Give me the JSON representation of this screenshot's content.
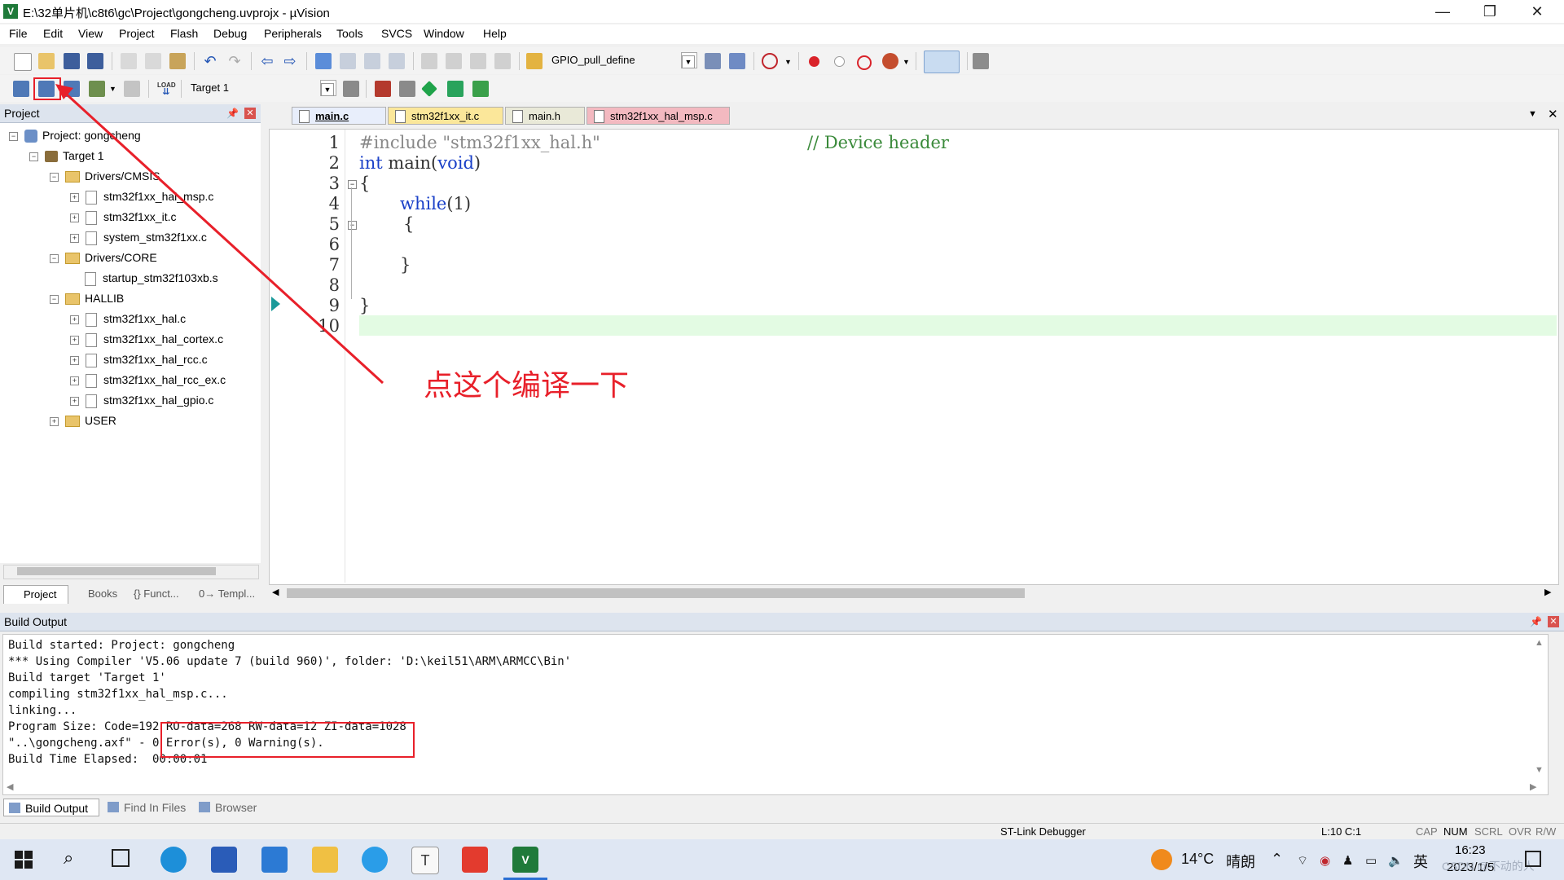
{
  "window": {
    "title": "E:\\32单片机\\c8t6\\gc\\Project\\gongcheng.uvprojx - µVision",
    "minimize": "—",
    "restore": "❐",
    "close": "✕"
  },
  "menu": [
    "File",
    "Edit",
    "View",
    "Project",
    "Flash",
    "Debug",
    "Peripherals",
    "Tools",
    "SVCS",
    "Window",
    "Help"
  ],
  "toolbar1": {
    "search_combo": "GPIO_pull_define"
  },
  "toolbar2": {
    "target_combo": "Target 1",
    "load_label": "LOAD"
  },
  "project_pane": {
    "title": "Project",
    "root": "Project: gongcheng",
    "target": "Target 1",
    "groups": [
      {
        "name": "Drivers/CMSIS",
        "files": [
          "stm32f1xx_hal_msp.c",
          "stm32f1xx_it.c",
          "system_stm32f1xx.c"
        ]
      },
      {
        "name": "Drivers/CORE",
        "files": [
          "startup_stm32f103xb.s"
        ]
      },
      {
        "name": "HALLIB",
        "files": [
          "stm32f1xx_hal.c",
          "stm32f1xx_hal_cortex.c",
          "stm32f1xx_hal_rcc.c",
          "stm32f1xx_hal_rcc_ex.c",
          "stm32f1xx_hal_gpio.c"
        ]
      },
      {
        "name": "USER",
        "files": []
      }
    ],
    "tabs": [
      "Project",
      "Books",
      "{} Funct...",
      "0→ Templ..."
    ]
  },
  "editor": {
    "tabs": [
      {
        "label": "main.c",
        "color": "#e8eefb"
      },
      {
        "label": "stm32f1xx_it.c",
        "color": "#fbe79a"
      },
      {
        "label": "main.h",
        "color": "#e9e9d8"
      },
      {
        "label": "stm32f1xx_hal_msp.c",
        "color": "#f3b9c0"
      }
    ],
    "line_numbers": [
      "1",
      "2",
      "3",
      "4",
      "5",
      "6",
      "7",
      "8",
      "9",
      "10"
    ],
    "code": {
      "l1_include": "#include ",
      "l1_header": "\"stm32f1xx_hal.h\"",
      "l1_comment": "// Device header",
      "l2_int": "int",
      "l2_main": " main(",
      "l2_void": "void",
      "l2_close": ")",
      "l3": "{",
      "l4_while": "while",
      "l4_args": "(1)",
      "l5": "{",
      "l7": "}",
      "l9": "}"
    }
  },
  "annotation": {
    "text": "点这个编译一下",
    "color": "#e8202a"
  },
  "build_output": {
    "title": "Build Output",
    "lines": [
      "Build started: Project: gongcheng",
      "*** Using Compiler 'V5.06 update 7 (build 960)', folder: 'D:\\keil51\\ARM\\ARMCC\\Bin'",
      "Build target 'Target 1'",
      "compiling stm32f1xx_hal_msp.c...",
      "linking...",
      "Program Size: Code=192 RO-data=268 RW-data=12 ZI-data=1028",
      "\"..\\gongcheng.axf\" - 0 Error(s), 0 Warning(s).",
      "Build Time Elapsed:  00:00:01"
    ],
    "tabs": [
      "Build Output",
      "Find In Files",
      "Browser"
    ]
  },
  "status": {
    "debugger": "ST-Link Debugger",
    "position": "L:10 C:1",
    "indicators": [
      "CAP",
      "NUM",
      "SCRL",
      "OVR",
      "R/W"
    ]
  },
  "taskbar": {
    "weather_temp": "14°C",
    "weather_text": "晴朗",
    "ime": "英",
    "time": "16:23",
    "date": "2023/1/5",
    "watermark": "CSDN @不动的人"
  }
}
